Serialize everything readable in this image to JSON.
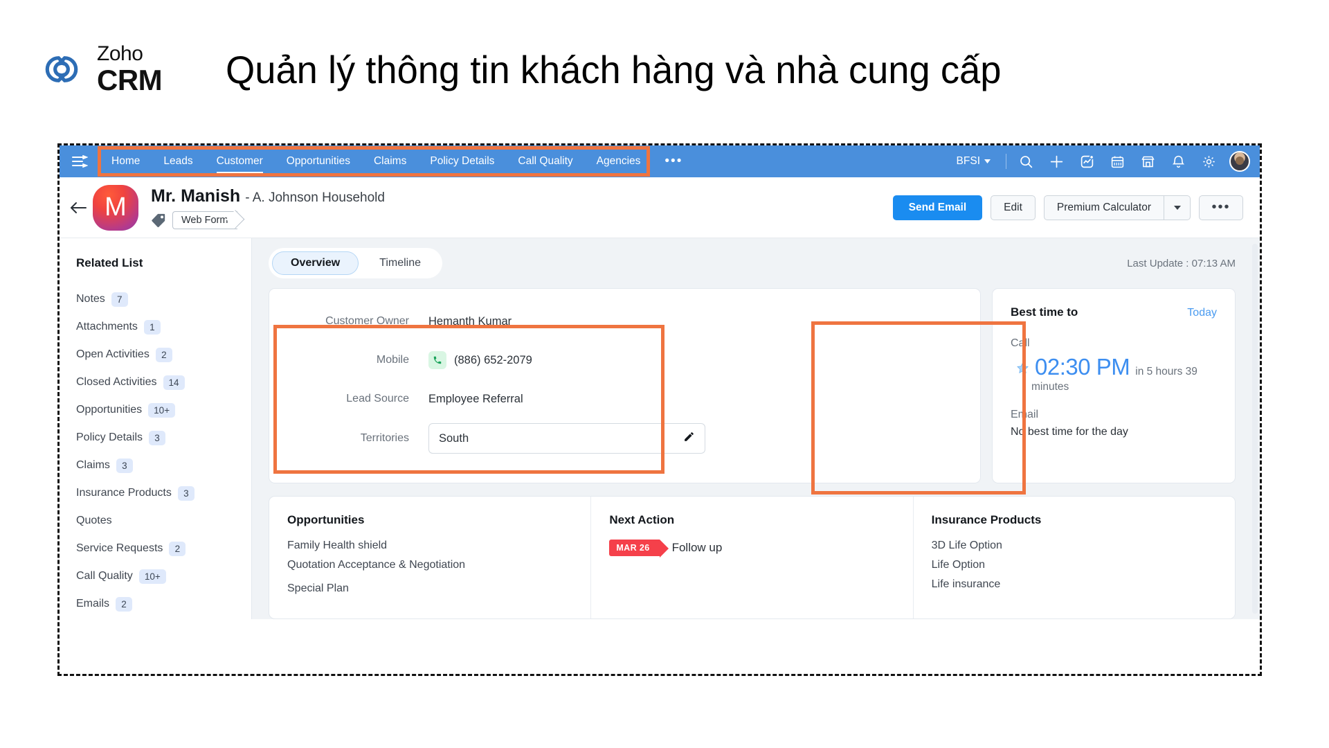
{
  "brand": {
    "zoho": "Zoho",
    "crm": "CRM",
    "logo_icon": "zoho-infinity-logo"
  },
  "page_title": "Quản lý thông tin khách hàng và nhà cung cấp",
  "nav": {
    "menu_icon": "hamburger-menu-icon",
    "items": [
      {
        "label": "Home",
        "active": false
      },
      {
        "label": "Leads",
        "active": false
      },
      {
        "label": "Customer",
        "active": true
      },
      {
        "label": "Opportunities",
        "active": false
      },
      {
        "label": "Claims",
        "active": false
      },
      {
        "label": "Policy Details",
        "active": false
      },
      {
        "label": "Call Quality",
        "active": false
      },
      {
        "label": "Agencies",
        "active": false
      }
    ],
    "more_label": "•••",
    "org": "BFSI",
    "icons": [
      "search-icon",
      "plus-icon",
      "analytics-icon",
      "calendar-icon",
      "marketplace-icon",
      "bell-icon",
      "gear-icon"
    ],
    "avatar": "user-avatar"
  },
  "record": {
    "back_icon": "back-arrow-icon",
    "avatar_initial": "M",
    "name": "Mr. Manish",
    "subtitle": "- A. Johnson Household",
    "tag_icon": "tag-icon",
    "tag_label": "Web Form",
    "actions": {
      "send_email": "Send Email",
      "edit": "Edit",
      "premium_calculator": "Premium Calculator",
      "more": "•••"
    }
  },
  "sidebar": {
    "title": "Related List",
    "items": [
      {
        "label": "Notes",
        "count": "7"
      },
      {
        "label": "Attachments",
        "count": "1"
      },
      {
        "label": "Open Activities",
        "count": "2"
      },
      {
        "label": "Closed Activities",
        "count": "14"
      },
      {
        "label": "Opportunities",
        "count": "10+"
      },
      {
        "label": "Policy Details",
        "count": "3"
      },
      {
        "label": "Claims",
        "count": "3"
      },
      {
        "label": "Insurance Products",
        "count": "3"
      },
      {
        "label": "Quotes",
        "count": ""
      },
      {
        "label": "Service Requests",
        "count": "2"
      },
      {
        "label": "Call Quality",
        "count": "10+"
      },
      {
        "label": "Emails",
        "count": "2"
      }
    ]
  },
  "main": {
    "tabs": [
      {
        "label": "Overview",
        "active": true
      },
      {
        "label": "Timeline",
        "active": false
      }
    ],
    "last_update": "Last Update : 07:13 AM",
    "fields": [
      {
        "label": "Customer Owner",
        "value": "Hemanth Kumar",
        "type": "text"
      },
      {
        "label": "Mobile",
        "value": "(886) 652-2079",
        "type": "phone"
      },
      {
        "label": "Lead Source",
        "value": "Employee Referral",
        "type": "text"
      },
      {
        "label": "Territories",
        "value": "South",
        "type": "input"
      }
    ],
    "best_time": {
      "title": "Best time to",
      "today": "Today",
      "call_label": "Call",
      "call_time": "02:30 PM",
      "call_delta": "in 5 hours 39",
      "call_delta_2": "minutes",
      "email_label": "Email",
      "email_value": "No best time for the day",
      "star_icon": "star-icon"
    },
    "panels": [
      {
        "title": "Opportunities",
        "lines": [
          "Family Health shield",
          "Quotation Acceptance & Negotiation",
          "Special Plan"
        ]
      },
      {
        "title": "Next Action",
        "action_date": "MAR 26",
        "action_text": "Follow up"
      },
      {
        "title": "Insurance Products",
        "lines": [
          "3D Life Option",
          "Life Option",
          "Life insurance"
        ]
      }
    ]
  },
  "colors": {
    "nav_blue": "#4a8fdc",
    "highlight_orange": "#ef7440",
    "primary_button": "#1a8cf0",
    "accent_link": "#4a9bf0",
    "badge_blue": "#dfe9fb",
    "flag_red": "#f5404a"
  }
}
